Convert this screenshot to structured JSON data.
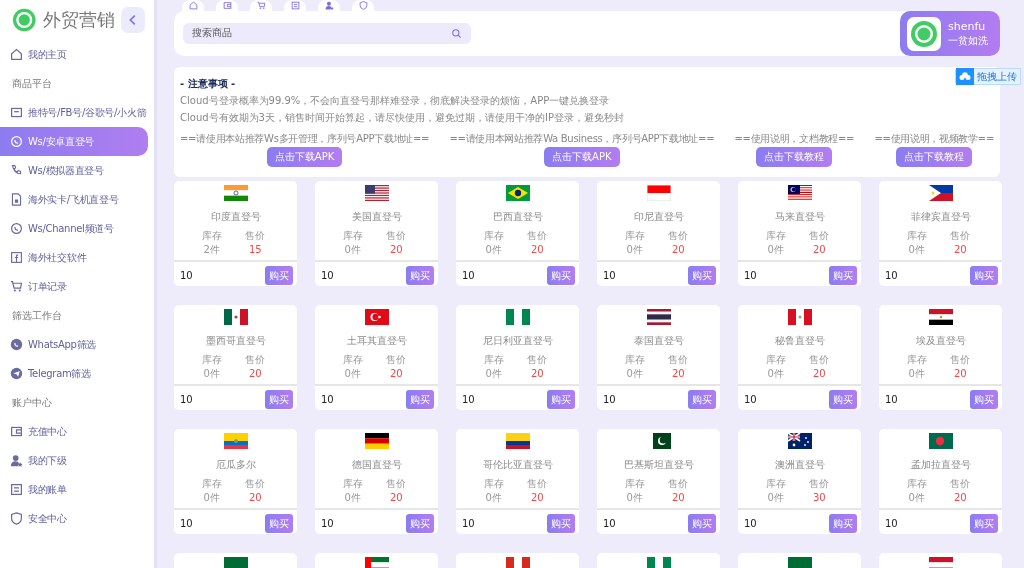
{
  "sidebar": {
    "logo_text": "外贸营销",
    "items": [
      {
        "kind": "item",
        "label": "我的主页",
        "selected": false
      },
      {
        "kind": "section",
        "label": "商品平台"
      },
      {
        "kind": "item",
        "label": "推特号/FB号/谷歌号/小火箭",
        "selected": false
      },
      {
        "kind": "item",
        "label": "Ws/安卓直登号",
        "selected": true
      },
      {
        "kind": "item",
        "label": "Ws/模拟器直登号",
        "selected": false
      },
      {
        "kind": "item",
        "label": "海外实卡/飞机直登号",
        "selected": false
      },
      {
        "kind": "item",
        "label": "Ws/Channel频道号",
        "selected": false
      },
      {
        "kind": "item",
        "label": "海外社交软件",
        "selected": false
      },
      {
        "kind": "item",
        "label": "订单记录",
        "selected": false
      },
      {
        "kind": "section",
        "label": "筛选工作台"
      },
      {
        "kind": "item",
        "label": "WhatsApp筛选",
        "selected": false
      },
      {
        "kind": "item",
        "label": "Telegram筛选",
        "selected": false
      },
      {
        "kind": "section",
        "label": "账户中心"
      },
      {
        "kind": "item",
        "label": "充值中心",
        "selected": false
      },
      {
        "kind": "item",
        "label": "我的下级",
        "selected": false
      },
      {
        "kind": "item",
        "label": "我的账单",
        "selected": false
      },
      {
        "kind": "item",
        "label": "安全中心",
        "selected": false
      }
    ]
  },
  "search": {
    "placeholder": "搜索商品"
  },
  "profile": {
    "name": "shenfu",
    "subtitle": "一贫如洗"
  },
  "upload_button": "拖拽上传",
  "notice": {
    "title": "- 注意事项 -",
    "lines": [
      "Cloud号登录概率为99.9%，不会向直登号那样难登录，彻底解决登录的烦恼，APP一键兑换登录",
      "Cloud号有效期为3天，销售时间开始算起，请尽快使用，避免过期，请使用干净的IP登录，避免秒封"
    ],
    "links": [
      {
        "caption": "==请使用本站推荐Ws多开管理，序列号APP下载地址==",
        "button": "点击下载APK"
      },
      {
        "caption": "==请使用本网站推荐Wa Business，序列号APP下载地址==",
        "button": "点击下载APK"
      },
      {
        "caption": "==使用说明，文档教程==",
        "button": "点击下载教程"
      },
      {
        "caption": "==使用说明，视频教学==",
        "button": "点击下载教程"
      }
    ]
  },
  "products": [
    {
      "kind": "in",
      "name": "印度直登号",
      "stock_label": "库存",
      "price_label": "售价",
      "stock": "2件",
      "price": "15",
      "quantity": "10",
      "buy": "购买"
    },
    {
      "kind": "us",
      "name": "美国直登号",
      "stock_label": "库存",
      "price_label": "售价",
      "stock": "0件",
      "price": "20",
      "quantity": "10",
      "buy": "购买"
    },
    {
      "kind": "br",
      "name": "巴西直登号",
      "stock_label": "库存",
      "price_label": "售价",
      "stock": "0件",
      "price": "20",
      "quantity": "10",
      "buy": "购买"
    },
    {
      "kind": "id",
      "name": "印尼直登号",
      "stock_label": "库存",
      "price_label": "售价",
      "stock": "0件",
      "price": "20",
      "quantity": "10",
      "buy": "购买"
    },
    {
      "kind": "my",
      "name": "马来直登号",
      "stock_label": "库存",
      "price_label": "售价",
      "stock": "0件",
      "price": "20",
      "quantity": "10",
      "buy": "购买"
    },
    {
      "kind": "ph",
      "name": "菲律宾直登号",
      "stock_label": "库存",
      "price_label": "售价",
      "stock": "0件",
      "price": "20",
      "quantity": "10",
      "buy": "购买"
    },
    {
      "kind": "mx",
      "name": "墨西哥直登号",
      "stock_label": "库存",
      "price_label": "售价",
      "stock": "0件",
      "price": "20",
      "quantity": "10",
      "buy": "购买"
    },
    {
      "kind": "tr",
      "name": "土耳其直登号",
      "stock_label": "库存",
      "price_label": "售价",
      "stock": "0件",
      "price": "20",
      "quantity": "10",
      "buy": "购买"
    },
    {
      "kind": "ng",
      "name": "尼日利亚直登号",
      "stock_label": "库存",
      "price_label": "售价",
      "stock": "0件",
      "price": "20",
      "quantity": "10",
      "buy": "购买"
    },
    {
      "kind": "th",
      "name": "泰国直登号",
      "stock_label": "库存",
      "price_label": "售价",
      "stock": "0件",
      "price": "20",
      "quantity": "10",
      "buy": "购买"
    },
    {
      "kind": "pe",
      "name": "秘鲁直登号",
      "stock_label": "库存",
      "price_label": "售价",
      "stock": "0件",
      "price": "20",
      "quantity": "10",
      "buy": "购买"
    },
    {
      "kind": "eg",
      "name": "埃及直登号",
      "stock_label": "库存",
      "price_label": "售价",
      "stock": "0件",
      "price": "20",
      "quantity": "10",
      "buy": "购买"
    },
    {
      "kind": "ec",
      "name": "厄瓜多尔",
      "stock_label": "库存",
      "price_label": "售价",
      "stock": "0件",
      "price": "20",
      "quantity": "10",
      "buy": "购买"
    },
    {
      "kind": "de",
      "name": "德国直登号",
      "stock_label": "库存",
      "price_label": "售价",
      "stock": "0件",
      "price": "20",
      "quantity": "10",
      "buy": "购买"
    },
    {
      "kind": "co",
      "name": "哥伦比亚直登号",
      "stock_label": "库存",
      "price_label": "售价",
      "stock": "0件",
      "price": "20",
      "quantity": "10",
      "buy": "购买"
    },
    {
      "kind": "pk",
      "name": "巴基斯坦直登号",
      "stock_label": "库存",
      "price_label": "售价",
      "stock": "0件",
      "price": "20",
      "quantity": "10",
      "buy": "购买"
    },
    {
      "kind": "au",
      "name": "澳洲直登号",
      "stock_label": "库存",
      "price_label": "售价",
      "stock": "0件",
      "price": "30",
      "quantity": "10",
      "buy": "购买"
    },
    {
      "kind": "bd",
      "name": "孟加拉直登号",
      "stock_label": "库存",
      "price_label": "售价",
      "stock": "0件",
      "price": "20",
      "quantity": "10",
      "buy": "购买"
    },
    {
      "kind": "sa"
    },
    {
      "kind": "ae"
    },
    {
      "kind": "ca"
    },
    {
      "kind": "ng"
    },
    {
      "kind": "sa"
    },
    {
      "kind": "ye"
    }
  ]
}
